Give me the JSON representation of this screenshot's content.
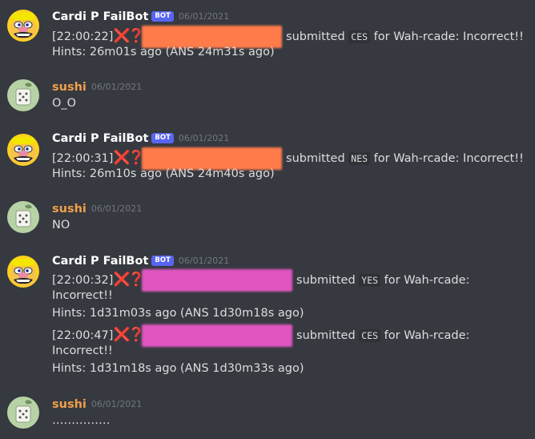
{
  "colors": {
    "background": "#36393f",
    "text": "#dcddde",
    "bot_username": "#ffffff",
    "sushi_username": "#f0a04b",
    "bot_tag": "#5865f2",
    "timestamp": "#72767d",
    "redact_orange": "#ff7b4a",
    "redact_pink": "#e055c0",
    "emoji_red": "#dd2e44"
  },
  "bot_user": {
    "name": "Cardi P FailBot",
    "tag": "BOT",
    "avatar_icon": "wario-face-icon"
  },
  "sushi_user": {
    "name": "sushi",
    "avatar_icon": "sushi-avatar-icon"
  },
  "emoji": {
    "cross": "❌",
    "question": "❓"
  },
  "messages": [
    {
      "author": "Cardi P FailBot",
      "time": "06/01/2021",
      "lines": [
        {
          "stamp": "[22:00:22]",
          "submitted": "submitted",
          "code": "CES",
          "rest": "for Wah-rcade: Incorrect!!"
        },
        {
          "text": "Hints: 26m01s ago (ANS 24m31s ago)"
        }
      ]
    },
    {
      "author": "sushi",
      "time": "06/01/2021",
      "text": "O_O"
    },
    {
      "author": "Cardi P FailBot",
      "time": "06/01/2021",
      "lines": [
        {
          "stamp": "[22:00:31]",
          "submitted": "submitted",
          "code": "NES",
          "rest": "for Wah-rcade: Incorrect!!"
        },
        {
          "text": "Hints: 26m10s ago (ANS 24m40s ago)"
        }
      ]
    },
    {
      "author": "sushi",
      "time": "06/01/2021",
      "text": "NO"
    },
    {
      "author": "Cardi P FailBot",
      "time": "06/01/2021",
      "lines": [
        {
          "stamp": "[22:00:32]",
          "submitted": "submitted",
          "code": "YES",
          "rest": "for Wah-rcade:",
          "wrap": "Incorrect!!"
        },
        {
          "text": "Hints: 1d31m03s ago (ANS 1d30m18s ago)"
        },
        {
          "stamp": "[22:00:47]",
          "submitted": "submitted",
          "code": "CES",
          "rest": "for Wah-rcade:",
          "wrap": "Incorrect!!"
        },
        {
          "text": "Hints: 1d31m18s ago (ANS 1d30m33s ago)"
        }
      ]
    },
    {
      "author": "sushi",
      "time": "06/01/2021",
      "text": "……………"
    }
  ]
}
